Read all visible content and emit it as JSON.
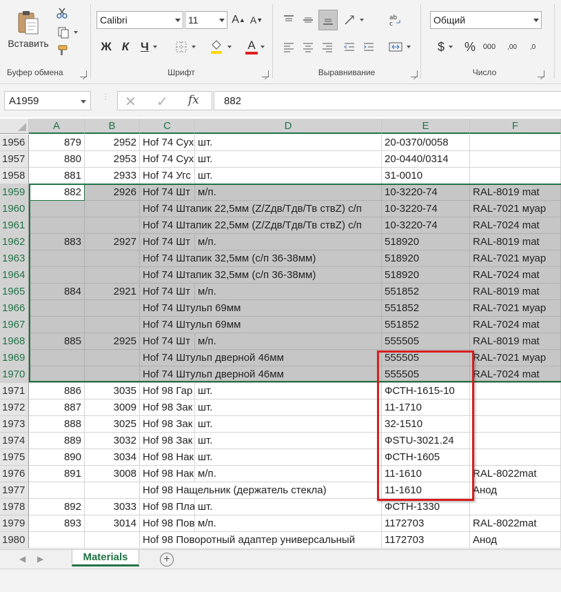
{
  "ribbon": {
    "clipboard": {
      "paste_label": "Вставить",
      "group_label": "Буфер обмена"
    },
    "font": {
      "font_name": "Calibri",
      "font_size": "11",
      "grow_label": "A",
      "shrink_label": "A",
      "bold_label": "Ж",
      "italic_label": "К",
      "underline_label": "Ч",
      "font_color_label": "А",
      "group_label": "Шрифт"
    },
    "alignment": {
      "group_label": "Выравнивание"
    },
    "number": {
      "format": "Общий",
      "currency_label": "$",
      "percent_label": "%",
      "thousands_label": "000",
      "inc_decimal_label": ",00",
      "dec_decimal_label": ",0",
      "group_label": "Число"
    },
    "colors": {
      "accent": "#217346",
      "fill_yellow": "#ffd700",
      "font_red": "#e02020"
    }
  },
  "formula_bar": {
    "name_box": "A1959",
    "fx_label": "fx",
    "value": "882"
  },
  "columns": [
    "A",
    "B",
    "C",
    "D",
    "E",
    "F"
  ],
  "rows": [
    {
      "r": "1956",
      "sel": false,
      "a": "879",
      "b": "2952",
      "c": "Hof 74 Сух",
      "d": "шт.",
      "e": "20-0370/0058",
      "f": ""
    },
    {
      "r": "1957",
      "sel": false,
      "a": "880",
      "b": "2953",
      "c": "Hof 74 Сух",
      "d": "шт.",
      "e": "20-0440/0314",
      "f": ""
    },
    {
      "r": "1958",
      "sel": false,
      "a": "881",
      "b": "2933",
      "c": "Hof 74 Угс",
      "d": "шт.",
      "e": "31-0010",
      "f": ""
    },
    {
      "r": "1959",
      "sel": true,
      "a": "882",
      "b": "2926",
      "c": "Hof 74 Шт",
      "d": "м/п.",
      "e": "10-3220-74",
      "f": "RAL-8019 mat"
    },
    {
      "r": "1960",
      "sel": true,
      "a": "",
      "b": "",
      "c": "Hof 74 Штапик 22,5мм (Z/Zдв/Тдв/Тв ствZ) с/п",
      "d": "",
      "e": "10-3220-74",
      "f": "RAL-7021 муар"
    },
    {
      "r": "1961",
      "sel": true,
      "a": "",
      "b": "",
      "c": "Hof 74 Штапик 22,5мм (Z/Zдв/Тдв/Тв ствZ) с/п",
      "d": "",
      "e": "10-3220-74",
      "f": "RAL-7024 mat"
    },
    {
      "r": "1962",
      "sel": true,
      "a": "883",
      "b": "2927",
      "c": "Hof 74 Шт",
      "d": "м/п.",
      "e": "518920",
      "f": "RAL-8019 mat"
    },
    {
      "r": "1963",
      "sel": true,
      "a": "",
      "b": "",
      "c": "Hof 74 Штапик 32,5мм (с/п 36-38мм)",
      "d": "",
      "e": "518920",
      "f": "RAL-7021 муар"
    },
    {
      "r": "1964",
      "sel": true,
      "a": "",
      "b": "",
      "c": "Hof 74 Штапик 32,5мм (с/п 36-38мм)",
      "d": "",
      "e": "518920",
      "f": "RAL-7024 mat"
    },
    {
      "r": "1965",
      "sel": true,
      "a": "884",
      "b": "2921",
      "c": "Hof 74 Шт",
      "d": "м/п.",
      "e": "551852",
      "f": "RAL-8019 mat"
    },
    {
      "r": "1966",
      "sel": true,
      "a": "",
      "b": "",
      "c": "Hof 74 Штульп 69мм",
      "d": "",
      "e": "551852",
      "f": "RAL-7021 муар"
    },
    {
      "r": "1967",
      "sel": true,
      "a": "",
      "b": "",
      "c": "Hof 74 Штульп 69мм",
      "d": "",
      "e": "551852",
      "f": "RAL-7024 mat"
    },
    {
      "r": "1968",
      "sel": true,
      "a": "885",
      "b": "2925",
      "c": "Hof 74 Шт",
      "d": "м/п.",
      "e": "555505",
      "f": "RAL-8019 mat"
    },
    {
      "r": "1969",
      "sel": true,
      "a": "",
      "b": "",
      "c": "Hof 74 Штульп дверной 46мм",
      "d": "",
      "e": "555505",
      "f": "RAL-7021 муар"
    },
    {
      "r": "1970",
      "sel": true,
      "a": "",
      "b": "",
      "c": "Hof 74 Штульп дверной 46мм",
      "d": "",
      "e": "555505",
      "f": "RAL-7024 mat"
    },
    {
      "r": "1971",
      "sel": false,
      "a": "886",
      "b": "3035",
      "c": "Hof 98 Гар",
      "d": "шт.",
      "e": "ФСТН-1615-10",
      "f": ""
    },
    {
      "r": "1972",
      "sel": false,
      "a": "887",
      "b": "3009",
      "c": "Hof 98 Зак",
      "d": "шт.",
      "e": "11-1710",
      "f": ""
    },
    {
      "r": "1973",
      "sel": false,
      "a": "888",
      "b": "3025",
      "c": "Hof 98 Зак",
      "d": "шт.",
      "e": "32-1510",
      "f": ""
    },
    {
      "r": "1974",
      "sel": false,
      "a": "889",
      "b": "3032",
      "c": "Hof 98 Зак",
      "d": "шт.",
      "e": "ФSTU-3021.24",
      "f": ""
    },
    {
      "r": "1975",
      "sel": false,
      "a": "890",
      "b": "3034",
      "c": "Hof 98 Нак",
      "d": "шт.",
      "e": "ФСТН-1605",
      "f": ""
    },
    {
      "r": "1976",
      "sel": false,
      "a": "891",
      "b": "3008",
      "c": "Hof 98 Нак",
      "d": "м/п.",
      "e": "11-1610",
      "f": "RAL-8022mat"
    },
    {
      "r": "1977",
      "sel": false,
      "a": "",
      "b": "",
      "c": "Hof 98 Нащельник (держатель стекла)",
      "d": "",
      "e": "11-1610",
      "f": "Анод"
    },
    {
      "r": "1978",
      "sel": false,
      "a": "892",
      "b": "3033",
      "c": "Hof 98 Пла",
      "d": "шт.",
      "e": "ФСТН-1330",
      "f": ""
    },
    {
      "r": "1979",
      "sel": false,
      "a": "893",
      "b": "3014",
      "c": "Hof 98 Пов",
      "d": "м/п.",
      "e": "1172703",
      "f": "RAL-8022mat"
    },
    {
      "r": "1980",
      "sel": false,
      "a": "",
      "b": "",
      "c": "Hof 98 Поворотный адаптер универсальный",
      "d": "",
      "e": "1172703",
      "f": "Анод"
    }
  ],
  "sheet_tabs": {
    "active": "Materials",
    "add_label": "+"
  }
}
